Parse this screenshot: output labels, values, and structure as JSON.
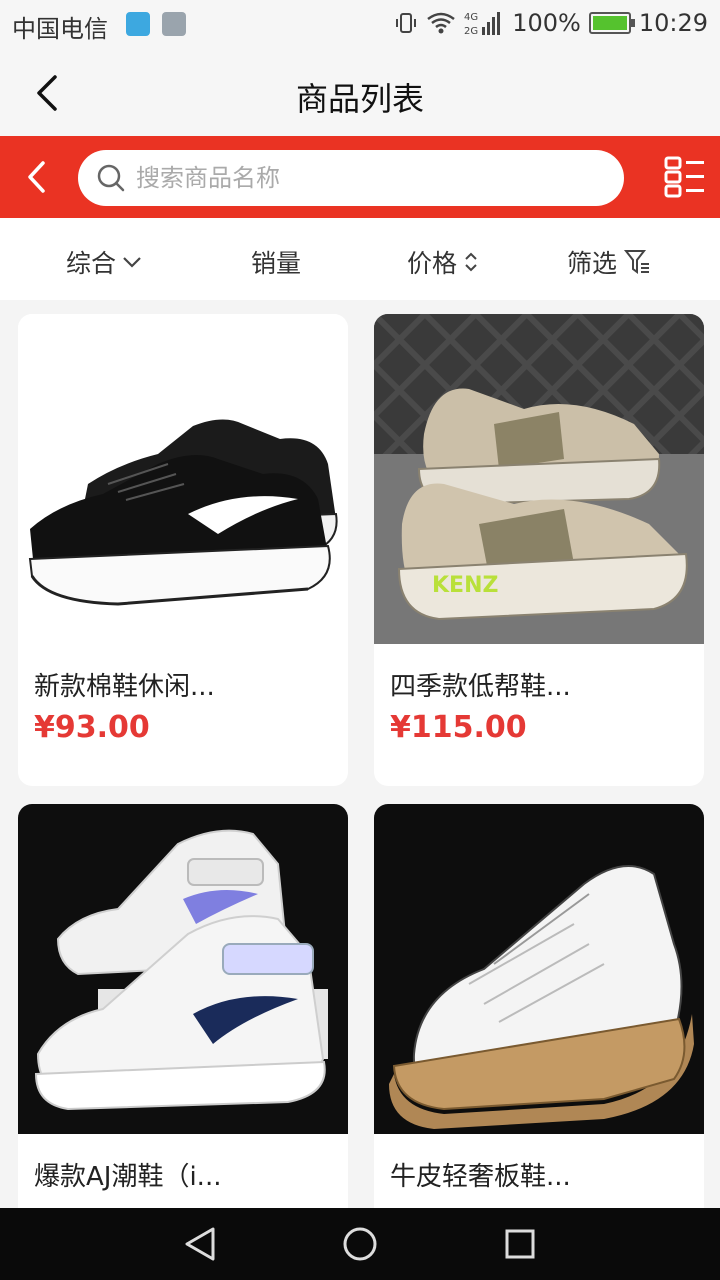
{
  "status_bar": {
    "carrier": "中国电信",
    "battery": "100%",
    "time": "10:29",
    "network": "4G 2G"
  },
  "title_bar": {
    "title": "商品列表"
  },
  "search": {
    "placeholder": "搜索商品名称"
  },
  "sort_bar": {
    "items": [
      {
        "label": "综合",
        "icon": "chevron-down-icon"
      },
      {
        "label": "销量",
        "icon": ""
      },
      {
        "label": "价格",
        "icon": "sort-arrows-icon"
      },
      {
        "label": "筛选",
        "icon": "filter-icon"
      }
    ]
  },
  "products": [
    {
      "name": "新款棉鞋休闲...",
      "price": "¥93.00"
    },
    {
      "name": "四季款低帮鞋...",
      "price": "¥115.00"
    },
    {
      "name": "爆款AJ潮鞋（i...",
      "price": ""
    },
    {
      "name": "牛皮轻奢板鞋...",
      "price": ""
    }
  ],
  "colors": {
    "accent": "#ea3323",
    "price": "#e53935"
  }
}
